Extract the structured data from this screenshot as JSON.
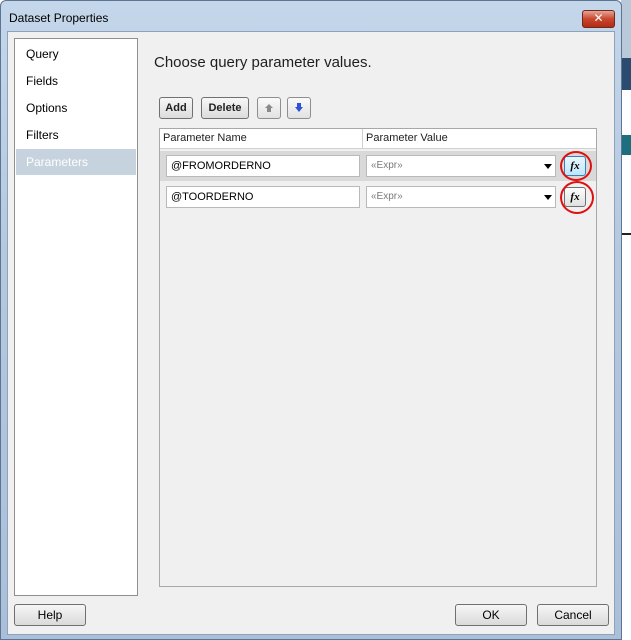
{
  "window": {
    "title": "Dataset Properties",
    "close_glyph": "✕"
  },
  "sidebar": {
    "items": [
      {
        "label": "Query"
      },
      {
        "label": "Fields"
      },
      {
        "label": "Options"
      },
      {
        "label": "Filters"
      },
      {
        "label": "Parameters",
        "selected": true
      }
    ]
  },
  "main": {
    "heading": "Choose query parameter values.",
    "toolbar": {
      "add_label": "Add",
      "delete_label": "Delete",
      "move_up_icon": "arrow-up-icon",
      "move_down_icon": "arrow-down-icon"
    },
    "grid": {
      "columns": [
        "Parameter Name",
        "Parameter Value"
      ],
      "rows": [
        {
          "name": "@FROMORDERNO",
          "value": "«Expr»",
          "fx": "fx"
        },
        {
          "name": "@TOORDERNO",
          "value": "«Expr»",
          "fx": "fx"
        }
      ]
    }
  },
  "footer": {
    "help_label": "Help",
    "ok_label": "OK",
    "cancel_label": "Cancel"
  },
  "colors": {
    "selected_sidebar": "#c7d2df",
    "annotation": "#e01010",
    "up_arrow": "#8a8a8a",
    "down_arrow": "#2a55d8"
  }
}
